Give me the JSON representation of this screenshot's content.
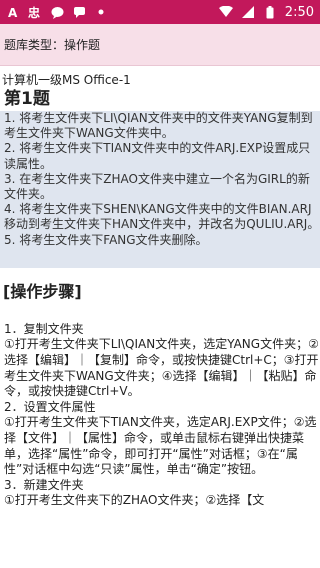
{
  "status_bar": {
    "left_icons": [
      "a-icon",
      "app-icon",
      "chat-icon",
      "message-icon",
      "dot-icon"
    ],
    "right_icons": [
      "wifi-icon",
      "signal-icon",
      "battery-icon"
    ],
    "time": "2:50"
  },
  "type_bar": {
    "text": "题库类型：操作题"
  },
  "question": {
    "subtitle": "计算机一级MS Office-1",
    "title": "第1题",
    "items": [
      "1. 将考生文件夹下LI\\QIAN文件夹中的文件夹YANG复制到考生文件夹下WANG文件夹中。",
      "2. 将考生文件夹下TIAN文件夹中的文件ARJ.EXP设置成只读属性。",
      "3. 在考生文件夹下ZHAO文件夹中建立一个名为GIRL的新文件夹。",
      "4. 将考生文件夹下SHEN\\KANG文件夹中的文件BIAN.ARJ移动到考生文件夹下HAN文件夹中，并改名为QULIU.ARJ。",
      "5. 将考生文件夹下FANG文件夹删除。"
    ]
  },
  "steps": {
    "title": "[操作步骤]",
    "lines": [
      "1．复制文件夹",
      "①打开考生文件夹下LI\\QIAN文件夹，选定YANG文件夹；②选择【编辑】｜【复制】命令，或按快捷键Ctrl+C；③打开考生文件夹下WANG文件夹；④选择【编辑】｜【粘贴】命令，或按快捷键Ctrl+V。",
      "2．设置文件属性",
      "①打开考生文件夹下TIAN文件夹，选定ARJ.EXP文件；②选择【文件】｜【属性】命令，或单击鼠标右键弹出快捷菜单，选择“属性”命令，即可打开“属性”对话框；③在“属性”对话框中勾选“只读”属性，单击“确定”按钮。",
      "3．新建文件夹",
      "①打开考生文件夹下的ZHAO文件夹；②选择【文"
    ]
  }
}
